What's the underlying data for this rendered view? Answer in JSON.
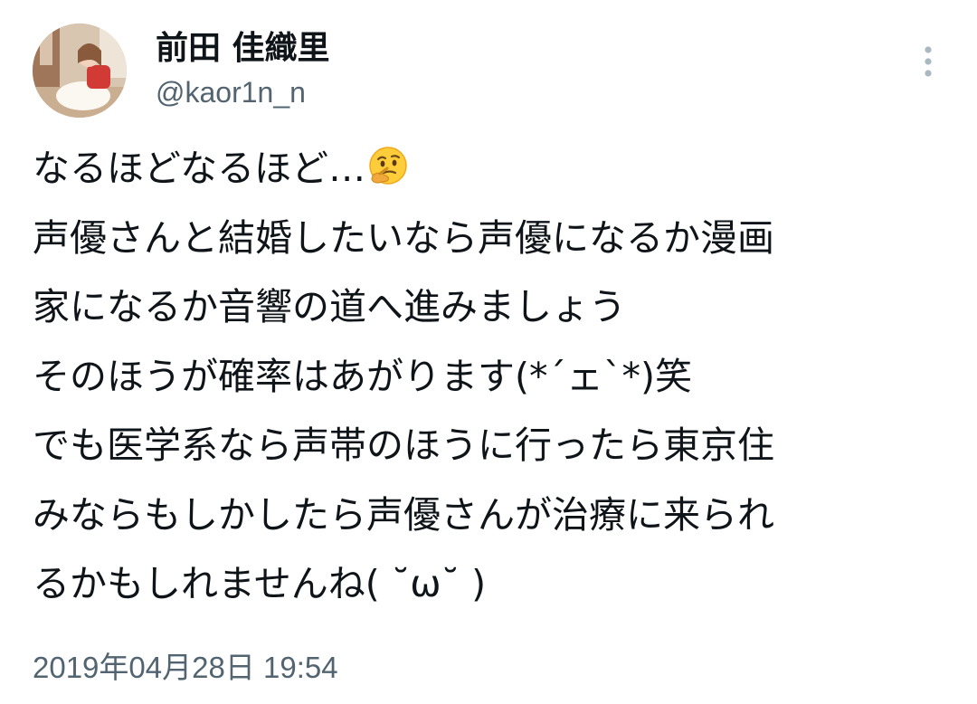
{
  "author": {
    "display_name": "前田 佳織里",
    "handle": "@kaor1n_n"
  },
  "tweet": {
    "lines": [
      "なるほどなるほど…",
      "声優さんと結婚したいなら声優になるか漫画",
      "家になるか音響の道へ進みましょう",
      "そのほうが確率はあがります(*´ェ`*)笑",
      "でも医学系なら声帯のほうに行ったら東京住",
      "みならもしかしたら声優さんが治療に来られ",
      "るかもしれませんね( ˘ω˘ )"
    ],
    "first_line_emoji": "thinking-face-icon",
    "timestamp": "2019年04月28日 19:54"
  },
  "icons": {
    "more": "more-vertical-icon"
  },
  "colors": {
    "text": "#0f1419",
    "secondary": "#536471",
    "background": "#ffffff"
  }
}
